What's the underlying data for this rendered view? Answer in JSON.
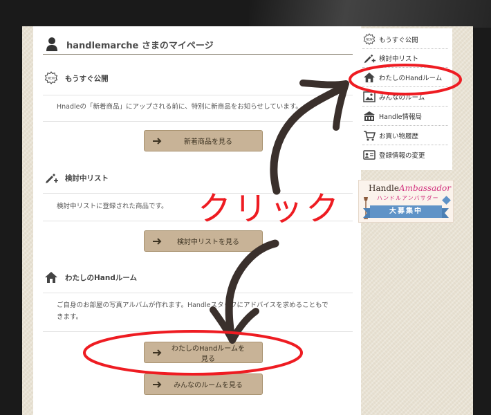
{
  "page": {
    "title": "handlemarche さまのマイページ"
  },
  "sections": [
    {
      "title": "もうすぐ公開",
      "icon": "new-badge-icon",
      "description": "Hnadleの「新着商品」にアップされる前に、特別に新商品をお知らせしています。",
      "button": "新着商品を見る"
    },
    {
      "title": "検討中リスト",
      "icon": "pen-plus-icon",
      "description": "検討中リストに登録された商品です。",
      "button": "検討中リストを見る"
    },
    {
      "title": "わたしのHandルーム",
      "icon": "house-icon",
      "description_line1": "ご自身のお部屋の写真アルバムが作れます。Handleスタッフにアドバイスを求めることもで",
      "description_line2": "きます。",
      "button": "わたしのHandルームを見る",
      "button2": "みんなのルームを見る"
    }
  ],
  "sidebar": {
    "items": [
      {
        "label": "もうすぐ公開",
        "icon": "new-badge-icon"
      },
      {
        "label": "検討中リスト",
        "icon": "pen-plus-icon"
      },
      {
        "label": "わたしのHandルーム",
        "icon": "house-icon"
      },
      {
        "label": "みんなのルーム",
        "icon": "photo-icon"
      },
      {
        "label": "Handle情報局",
        "icon": "building-icon"
      },
      {
        "label": "お買い物履歴",
        "icon": "cart-icon"
      },
      {
        "label": "登録情報の変更",
        "icon": "id-card-icon"
      }
    ]
  },
  "banner": {
    "logo_main": "Handle",
    "logo_accent": "Ambassador",
    "subtitle": "ハンドルアンバサダー",
    "ribbon": "大募集中"
  },
  "annotation": {
    "text": "クリック",
    "color": "#ee1c22"
  },
  "colors": {
    "button_bg": "#c8b397",
    "accent_red": "#ee1c22",
    "arrow_brown": "#3a302c"
  }
}
